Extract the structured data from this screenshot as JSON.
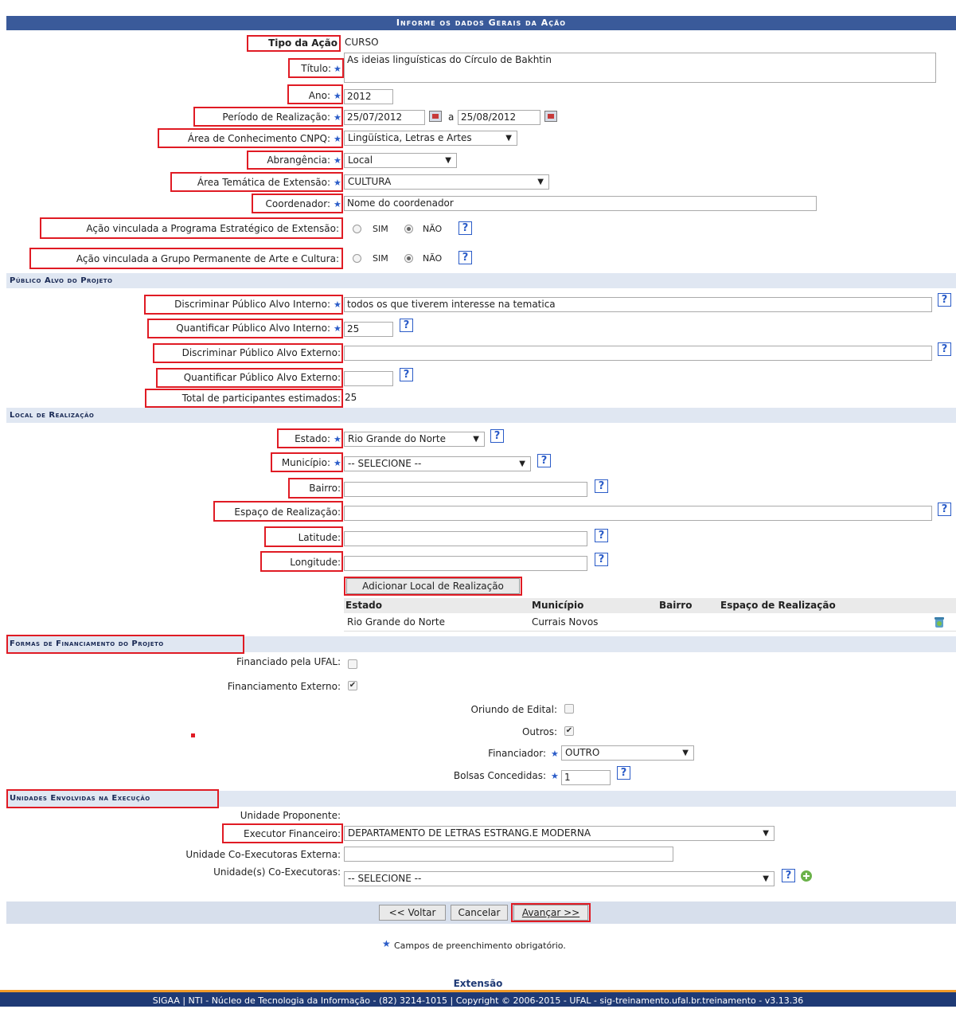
{
  "header": {
    "title": "Informe os dados Gerais da Ação"
  },
  "general": {
    "tipo_label": "Tipo da Ação",
    "tipo_value": "CURSO",
    "titulo_label": "Título:",
    "titulo_value": "As ideias linguísticas do Círculo de Bakhtin",
    "ano_label": "Ano:",
    "ano_value": "2012",
    "periodo_label": "Período de Realização:",
    "periodo_inicio": "25/07/2012",
    "periodo_sep": "a",
    "periodo_fim": "25/08/2012",
    "area_cnpq_label": "Área de Conhecimento CNPQ:",
    "area_cnpq_value": "Lingüística, Letras e Artes",
    "abrangencia_label": "Abrangência:",
    "abrangencia_value": "Local",
    "area_tematica_label": "Área Temática de Extensão:",
    "area_tematica_value": "CULTURA",
    "coordenador_label": "Coordenador:",
    "coordenador_value": "Nome do coordenador",
    "programa_label": "Ação vinculada a Programa Estratégico de Extensão:",
    "grupo_label": "Ação vinculada a Grupo Permanente de Arte e Cultura:",
    "sim": "SIM",
    "nao": "NÃO"
  },
  "publico": {
    "section_title": "Público Alvo do Projeto",
    "disc_interno_label": "Discriminar Público Alvo Interno:",
    "disc_interno_value": "todos os que tiverem interesse na tematica",
    "quant_interno_label": "Quantificar Público Alvo Interno:",
    "quant_interno_value": "25",
    "disc_externo_label": "Discriminar Público Alvo Externo:",
    "quant_externo_label": "Quantificar Público Alvo Externo:",
    "total_label": "Total de participantes estimados:",
    "total_value": "25"
  },
  "local": {
    "section_title": "Local de Realização",
    "estado_label": "Estado:",
    "estado_value": "Rio Grande do Norte",
    "municipio_label": "Município:",
    "municipio_value": "-- SELECIONE --",
    "bairro_label": "Bairro:",
    "espaco_label": "Espaço de Realização:",
    "latitude_label": "Latitude:",
    "longitude_label": "Longitude:",
    "add_button": "Adicionar Local de Realização",
    "table_headers": [
      "Estado",
      "Município",
      "Bairro",
      "Espaço de Realização"
    ],
    "table_rows": [
      [
        "Rio Grande do Norte",
        "Currais Novos",
        "",
        ""
      ]
    ]
  },
  "financiamento": {
    "section_title": "Formas de Financiamento do Projeto",
    "ufal_label": "Financiado pela UFAL:",
    "externo_label": "Financiamento Externo:",
    "edital_label": "Oriundo de Edital:",
    "outros_label": "Outros:",
    "financiador_label": "Financiador:",
    "financiador_value": "OUTRO",
    "bolsas_label": "Bolsas Concedidas:",
    "bolsas_value": "1"
  },
  "unidades": {
    "section_title": "Unidades Envolvidas na Execução",
    "proponente_label": "Unidade Proponente:",
    "executor_label": "Executor Financeiro:",
    "executor_value": "DEPARTAMENTO DE LETRAS ESTRANG.E MODERNA",
    "coexec_externa_label": "Unidade Co-Executoras Externa:",
    "coexec_label": "Unidade(s) Co-Executoras:",
    "coexec_value": "-- SELECIONE --"
  },
  "actions": {
    "voltar": "<< Voltar",
    "cancelar": "Cancelar",
    "avancar": "Avançar >>"
  },
  "note": "Campos de preenchimento obrigatório.",
  "footer": {
    "module": "Extensão",
    "text": "SIGAA | NTI - Núcleo de Tecnologia da Informação - (82) 3214-1015 | Copyright © 2006-2015 - UFAL - sig-treinamento.ufal.br.treinamento - v3.13.36"
  },
  "colors": {
    "header_bg": "#3a5a9a",
    "section_bg": "#e0e7f2",
    "highlight_border": "#e01b24",
    "required_star": "#2b5cc8",
    "footer_bg": "#1f3a75",
    "footer_accent": "#f09a28"
  }
}
